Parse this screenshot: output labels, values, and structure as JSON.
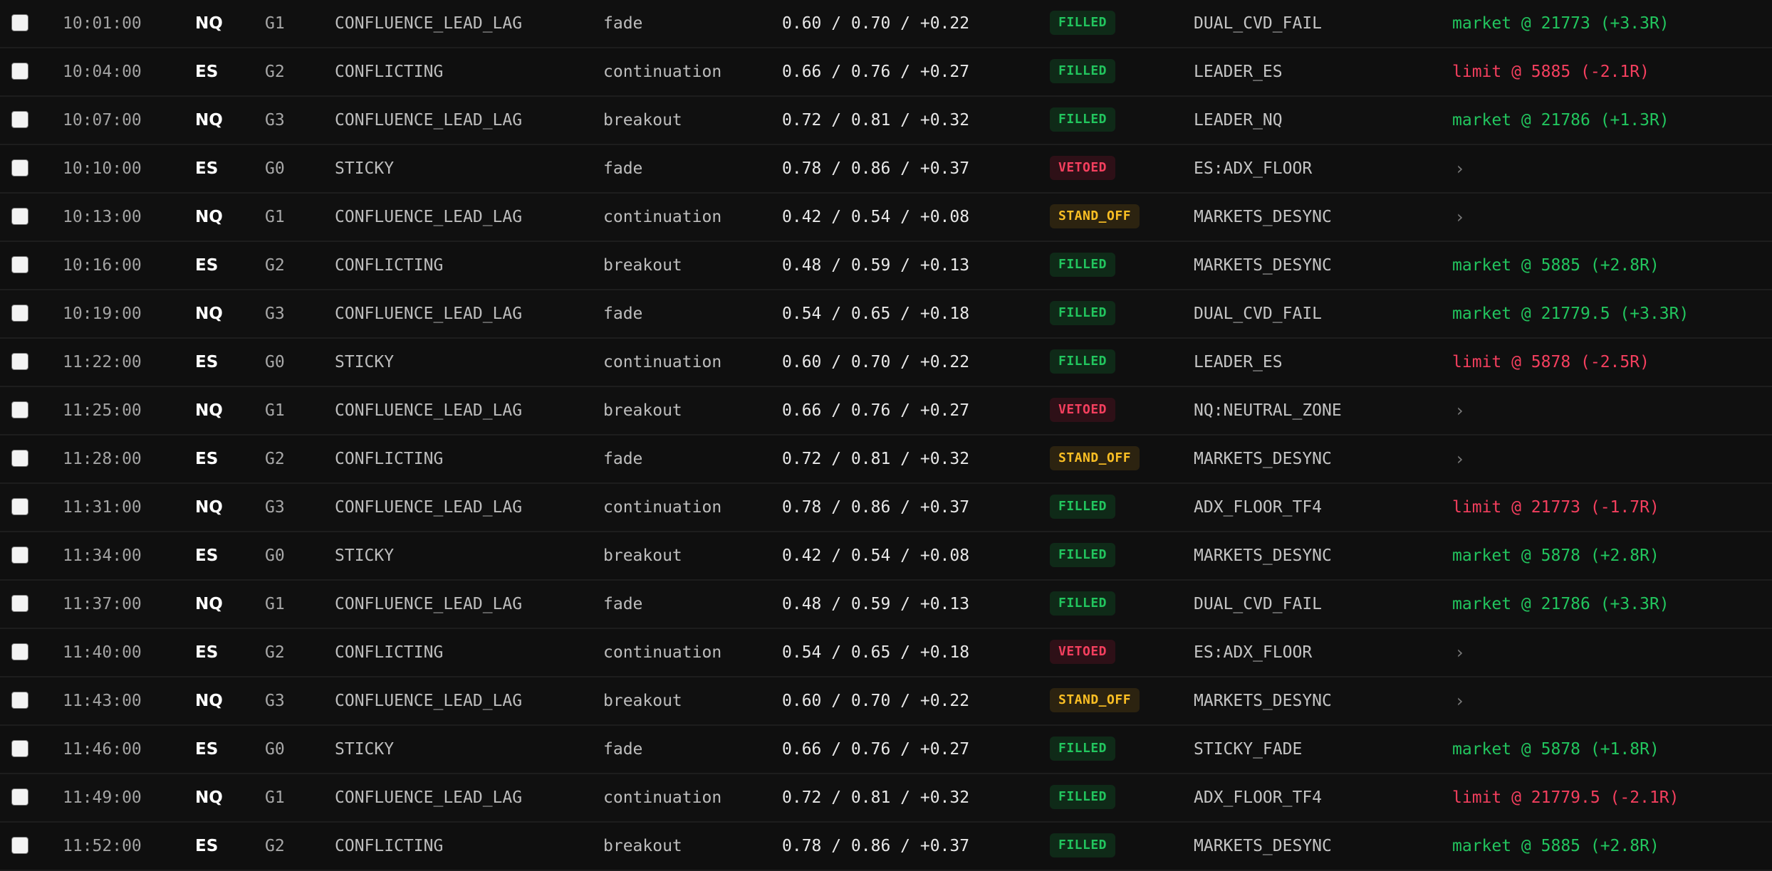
{
  "rows": [
    {
      "time": "10:01:00",
      "symbol": "NQ",
      "grade": "G1",
      "regime": "CONFLUENCE_LEAD_LAG",
      "setup": "fade",
      "scores": "0.60 / 0.70 / +0.22",
      "status": "FILLED",
      "reason": "DUAL_CVD_FAIL",
      "outcome": "market @ 21773 (+3.3R)",
      "outcome_sign": "pos"
    },
    {
      "time": "10:04:00",
      "symbol": "ES",
      "grade": "G2",
      "regime": "CONFLICTING",
      "setup": "continuation",
      "scores": "0.66 / 0.76 / +0.27",
      "status": "FILLED",
      "reason": "LEADER_ES",
      "outcome": "limit @ 5885 (-2.1R)",
      "outcome_sign": "neg"
    },
    {
      "time": "10:07:00",
      "symbol": "NQ",
      "grade": "G3",
      "regime": "CONFLUENCE_LEAD_LAG",
      "setup": "breakout",
      "scores": "0.72 / 0.81 / +0.32",
      "status": "FILLED",
      "reason": "LEADER_NQ",
      "outcome": "market @ 21786 (+1.3R)",
      "outcome_sign": "pos"
    },
    {
      "time": "10:10:00",
      "symbol": "ES",
      "grade": "G0",
      "regime": "STICKY",
      "setup": "fade",
      "scores": "0.78 / 0.86 / +0.37",
      "status": "VETOED",
      "reason": "ES:ADX_FLOOR",
      "outcome": "›",
      "outcome_sign": "none"
    },
    {
      "time": "10:13:00",
      "symbol": "NQ",
      "grade": "G1",
      "regime": "CONFLUENCE_LEAD_LAG",
      "setup": "continuation",
      "scores": "0.42 / 0.54 / +0.08",
      "status": "STAND_OFF",
      "reason": "MARKETS_DESYNC",
      "outcome": "›",
      "outcome_sign": "none"
    },
    {
      "time": "10:16:00",
      "symbol": "ES",
      "grade": "G2",
      "regime": "CONFLICTING",
      "setup": "breakout",
      "scores": "0.48 / 0.59 / +0.13",
      "status": "FILLED",
      "reason": "MARKETS_DESYNC",
      "outcome": "market @ 5885 (+2.8R)",
      "outcome_sign": "pos"
    },
    {
      "time": "10:19:00",
      "symbol": "NQ",
      "grade": "G3",
      "regime": "CONFLUENCE_LEAD_LAG",
      "setup": "fade",
      "scores": "0.54 / 0.65 / +0.18",
      "status": "FILLED",
      "reason": "DUAL_CVD_FAIL",
      "outcome": "market @ 21779.5 (+3.3R)",
      "outcome_sign": "pos"
    },
    {
      "time": "11:22:00",
      "symbol": "ES",
      "grade": "G0",
      "regime": "STICKY",
      "setup": "continuation",
      "scores": "0.60 / 0.70 / +0.22",
      "status": "FILLED",
      "reason": "LEADER_ES",
      "outcome": "limit @ 5878 (-2.5R)",
      "outcome_sign": "neg"
    },
    {
      "time": "11:25:00",
      "symbol": "NQ",
      "grade": "G1",
      "regime": "CONFLUENCE_LEAD_LAG",
      "setup": "breakout",
      "scores": "0.66 / 0.76 / +0.27",
      "status": "VETOED",
      "reason": "NQ:NEUTRAL_ZONE",
      "outcome": "›",
      "outcome_sign": "none"
    },
    {
      "time": "11:28:00",
      "symbol": "ES",
      "grade": "G2",
      "regime": "CONFLICTING",
      "setup": "fade",
      "scores": "0.72 / 0.81 / +0.32",
      "status": "STAND_OFF",
      "reason": "MARKETS_DESYNC",
      "outcome": "›",
      "outcome_sign": "none"
    },
    {
      "time": "11:31:00",
      "symbol": "NQ",
      "grade": "G3",
      "regime": "CONFLUENCE_LEAD_LAG",
      "setup": "continuation",
      "scores": "0.78 / 0.86 / +0.37",
      "status": "FILLED",
      "reason": "ADX_FLOOR_TF4",
      "outcome": "limit @ 21773 (-1.7R)",
      "outcome_sign": "neg"
    },
    {
      "time": "11:34:00",
      "symbol": "ES",
      "grade": "G0",
      "regime": "STICKY",
      "setup": "breakout",
      "scores": "0.42 / 0.54 / +0.08",
      "status": "FILLED",
      "reason": "MARKETS_DESYNC",
      "outcome": "market @ 5878 (+2.8R)",
      "outcome_sign": "pos"
    },
    {
      "time": "11:37:00",
      "symbol": "NQ",
      "grade": "G1",
      "regime": "CONFLUENCE_LEAD_LAG",
      "setup": "fade",
      "scores": "0.48 / 0.59 / +0.13",
      "status": "FILLED",
      "reason": "DUAL_CVD_FAIL",
      "outcome": "market @ 21786 (+3.3R)",
      "outcome_sign": "pos"
    },
    {
      "time": "11:40:00",
      "symbol": "ES",
      "grade": "G2",
      "regime": "CONFLICTING",
      "setup": "continuation",
      "scores": "0.54 / 0.65 / +0.18",
      "status": "VETOED",
      "reason": "ES:ADX_FLOOR",
      "outcome": "›",
      "outcome_sign": "none"
    },
    {
      "time": "11:43:00",
      "symbol": "NQ",
      "grade": "G3",
      "regime": "CONFLUENCE_LEAD_LAG",
      "setup": "breakout",
      "scores": "0.60 / 0.70 / +0.22",
      "status": "STAND_OFF",
      "reason": "MARKETS_DESYNC",
      "outcome": "›",
      "outcome_sign": "none"
    },
    {
      "time": "11:46:00",
      "symbol": "ES",
      "grade": "G0",
      "regime": "STICKY",
      "setup": "fade",
      "scores": "0.66 / 0.76 / +0.27",
      "status": "FILLED",
      "reason": "STICKY_FADE",
      "outcome": "market @ 5878 (+1.8R)",
      "outcome_sign": "pos"
    },
    {
      "time": "11:49:00",
      "symbol": "NQ",
      "grade": "G1",
      "regime": "CONFLUENCE_LEAD_LAG",
      "setup": "continuation",
      "scores": "0.72 / 0.81 / +0.32",
      "status": "FILLED",
      "reason": "ADX_FLOOR_TF4",
      "outcome": "limit @ 21779.5 (-2.1R)",
      "outcome_sign": "neg"
    },
    {
      "time": "11:52:00",
      "symbol": "ES",
      "grade": "G2",
      "regime": "CONFLICTING",
      "setup": "breakout",
      "scores": "0.78 / 0.86 / +0.37",
      "status": "FILLED",
      "reason": "MARKETS_DESYNC",
      "outcome": "market @ 5885 (+2.8R)",
      "outcome_sign": "pos"
    }
  ],
  "colors": {
    "filled": "#22c55e",
    "vetoed": "#f43f5e",
    "stand_off": "#fbbf24",
    "positive": "#22c55e",
    "negative": "#f43f5e"
  },
  "icons": {
    "expand": "chevron-right-icon"
  }
}
